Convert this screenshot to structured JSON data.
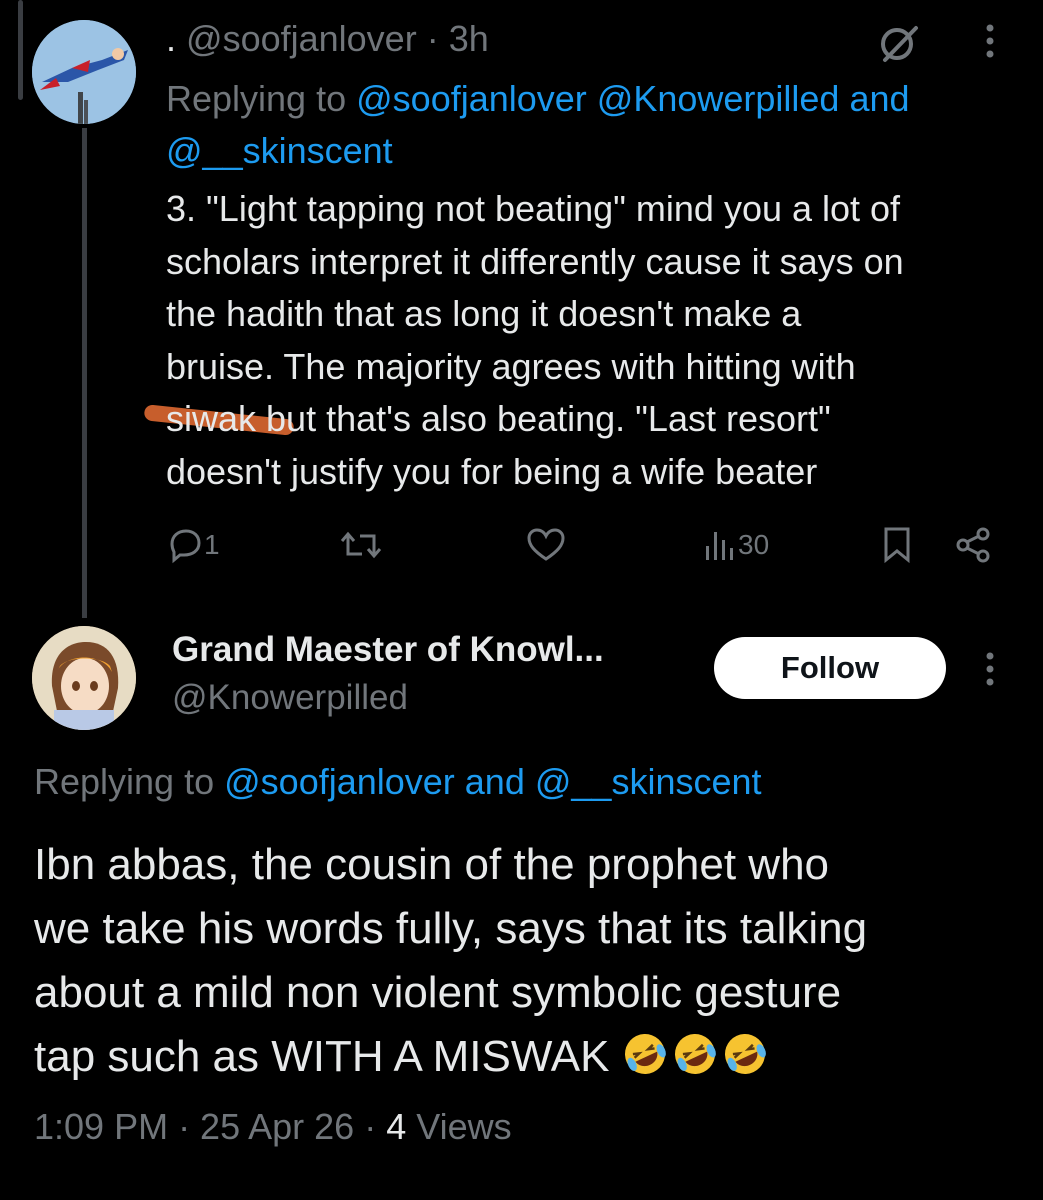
{
  "tweet1": {
    "dot": ".",
    "handle": "@soofjanlover",
    "time": "· 3h",
    "replying_prefix": "Replying to",
    "replying_line1": "@soofjanlover @Knowerpilled and",
    "replying_line2": "@__skinscent",
    "body_lines": [
      "3. \"Light tapping not beating\" mind you a lot of",
      "scholars interpret it differently cause it says on",
      "the hadith that as long it doesn't make a",
      "bruise. The majority agrees with hitting with"
    ],
    "highlight_word": "siwak",
    "body_line5_rest": " but that's also beating. \"Last resort\"",
    "body_line6": "doesn't justify you for being a wife beater",
    "replies": "1",
    "views": "30"
  },
  "tweet2": {
    "name": "Grand Maester of Knowl...",
    "handle": "@Knowerpilled",
    "follow_label": "Follow",
    "replying_prefix": "Replying to",
    "replying_targets": "@soofjanlover and @__skinscent",
    "body_lines": [
      "Ibn abbas, the cousin of the prophet who",
      "we take his words fully, says that its talking",
      "about a mild non violent symbolic gesture",
      "tap  such as WITH A MISWAK"
    ],
    "emojis": [
      "rofl",
      "rofl",
      "rofl"
    ],
    "time": "1:09 PM · 25 Apr 26 ·",
    "views_count": "4",
    "views_label": "Views"
  },
  "icons": [
    "grok-icon",
    "more-icon",
    "reply-icon",
    "retweet-icon",
    "like-icon",
    "views-icon",
    "bookmark-icon",
    "share-icon"
  ],
  "colors": {
    "background": "#000000",
    "text": "#e7e9ea",
    "muted": "#71767b",
    "link": "#1d9bf0",
    "highlight": "#d2632e"
  }
}
